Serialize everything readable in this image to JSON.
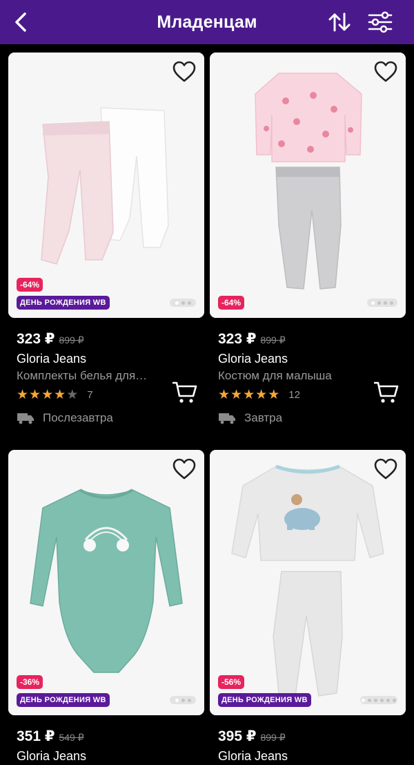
{
  "header": {
    "title": "Младенцам",
    "back_icon": "back-arrow-icon",
    "sort_icon": "sort-icon",
    "filter_icon": "filter-icon",
    "background_color": "#4a1a8c"
  },
  "colors": {
    "discount_badge": "#e6245e",
    "birthday_badge": "#5a1a9a",
    "star": "#f3a73b"
  },
  "products": [
    {
      "price": "323 ₽",
      "old_price": "899 ₽",
      "brand": "Gloria Jeans",
      "name": "Комплекты белья для…",
      "rating_stars": 4,
      "rating_count": "7",
      "delivery": "Послезавтра",
      "discount": "-64%",
      "birthday_label": "ДЕНЬ РОЖДЕНИЯ WB",
      "image_slides": 3
    },
    {
      "price": "323 ₽",
      "old_price": "899 ₽",
      "brand": "Gloria Jeans",
      "name": "Костюм для малыша",
      "rating_stars": 5,
      "rating_count": "12",
      "delivery": "Завтра",
      "discount": "-64%",
      "birthday_label": "",
      "image_slides": 4
    },
    {
      "price": "351 ₽",
      "old_price": "549 ₽",
      "brand": "Gloria Jeans",
      "discount": "-36%",
      "birthday_label": "ДЕНЬ РОЖДЕНИЯ WB",
      "image_slides": 3
    },
    {
      "price": "395 ₽",
      "old_price": "899 ₽",
      "brand": "Gloria Jeans",
      "discount": "-56%",
      "birthday_label": "ДЕНЬ РОЖДЕНИЯ WB",
      "image_slides": 6
    }
  ]
}
